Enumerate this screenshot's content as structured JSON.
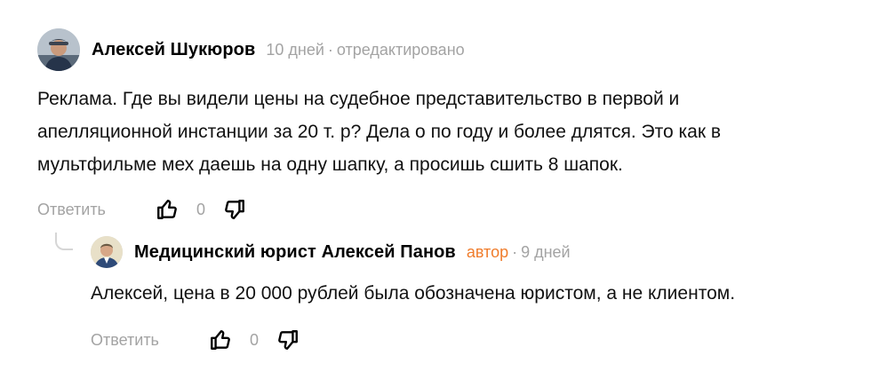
{
  "comments": [
    {
      "author": "Алексей Шукюров",
      "time": "10 дней",
      "edited": "отредактировано",
      "text": "Реклама. Где вы видели цены на судебное представительство в первой и\nапелляционной инстанции за 20 т. р? Дела о по году и более длятся. Это как в\nмультфильме мех даешь на одну шапку, а просишь сшить 8 шапок.",
      "reply_label": "Ответить",
      "votes": "0",
      "like_icon": "thumb-up-icon",
      "dislike_icon": "thumb-down-icon"
    },
    {
      "author": "Медицинский юрист Алексей Панов",
      "badge": "автор",
      "time": "9 дней",
      "text": "Алексей, цена в 20 000 рублей была обозначена юристом, а не клиентом.",
      "reply_label": "Ответить",
      "votes": "0",
      "like_icon": "thumb-up-icon",
      "dislike_icon": "thumb-down-icon"
    }
  ],
  "colors": {
    "meta": "#a3a3a3",
    "author_badge": "#f07c2b",
    "text": "#111111"
  }
}
